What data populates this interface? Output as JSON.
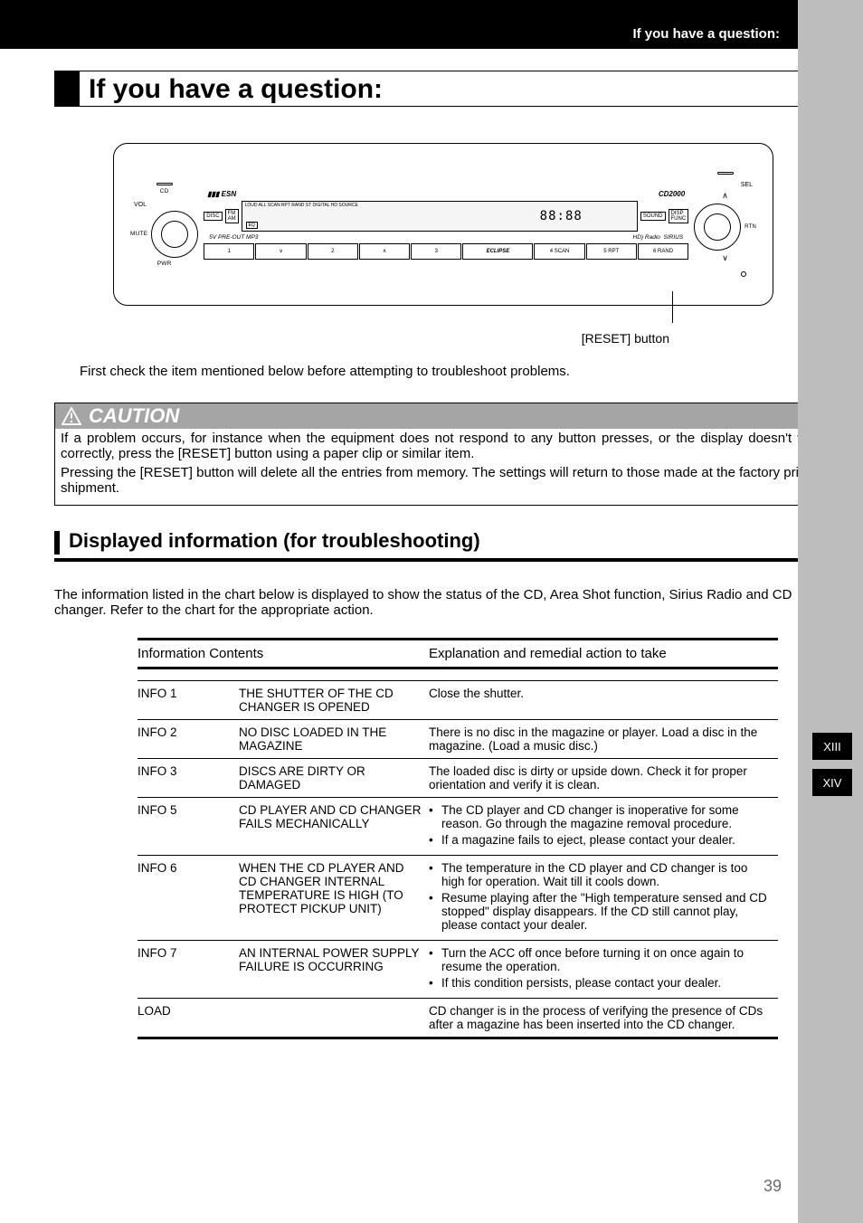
{
  "header_label": "If you have a question:",
  "page_title": "If you have a question:",
  "device": {
    "brand_small": "ESN",
    "model": "CD2000",
    "eclipse": "ECLIPSE",
    "vol": "VOL",
    "sel": "SEL",
    "cd": "CD",
    "disc": "DISC",
    "mute": "MUTE",
    "fm": "FM",
    "am": "AM",
    "pwr": "PWR",
    "sound": "SOUND",
    "disp": "DISP",
    "func": "FUNC",
    "rtn": "RTN",
    "preout": "5V PRE-OUT  MP3",
    "hd": "HD) Radio",
    "sirius": "SIRIUS",
    "lcd_top": "LOUD  ALL SCAN RPT RAND  ST  DIGITAL HD   SOURCE",
    "eq": "EQ",
    "btn1": "1",
    "btn2": "2",
    "btn3": "3",
    "btn4": "4  SCAN",
    "btn5": "5    RPT",
    "btn6": "6  RAND",
    "down": "∨",
    "up": "∧"
  },
  "reset_caption": "[RESET] button",
  "intro": "First check the item mentioned below before attempting to troubleshoot problems.",
  "caution": {
    "title": "CAUTION",
    "p1": "If a problem occurs, for instance when the equipment does not respond to any button presses, or the display doesn't work correctly, press the [RESET] button using a paper clip or similar item.",
    "p2": "Pressing the [RESET] button will delete all the entries from memory. The settings will return to those made at the factory prior to shipment."
  },
  "section_head": "Displayed information (for troubleshooting)",
  "section_intro": "The information listed in the chart below is displayed to show the status of the CD, Area Shot function, Sirius Radio and CD changer. Refer to the chart for the appropriate action.",
  "table": {
    "head_left": "Information Contents",
    "head_right": "Explanation and remedial action to take",
    "rows": [
      {
        "code": "INFO 1",
        "content": "THE SHUTTER OF THE CD CHANGER IS OPENED",
        "expl": [
          "Close the shutter."
        ],
        "plain": true
      },
      {
        "code": "INFO 2",
        "content": "NO DISC LOADED IN THE MAGAZINE",
        "expl": [
          "There is no disc in the magazine or player. Load a disc in the magazine. (Load a music disc.)"
        ],
        "plain": true
      },
      {
        "code": "INFO 3",
        "content": "DISCS ARE DIRTY OR DAMAGED",
        "expl": [
          "The loaded disc is dirty or upside down. Check it for proper orientation and verify it is clean."
        ],
        "plain": true
      },
      {
        "code": "INFO 5",
        "content": "CD PLAYER AND CD CHANGER FAILS MECHANICALLY",
        "expl": [
          "The CD player and CD changer is inoperative for some reason. Go through the magazine removal procedure.",
          "If a magazine fails to eject, please contact your dealer."
        ],
        "plain": false
      },
      {
        "code": "INFO 6",
        "content": "WHEN THE CD PLAYER AND CD CHANGER INTERNAL TEMPERATURE IS HIGH (TO PROTECT PICKUP UNIT)",
        "expl": [
          "The temperature in the CD player and CD changer is too high for operation. Wait till it cools down.",
          "Resume playing after the \"High temperature sensed and CD stopped\" display disappears. If the CD still cannot play, please contact your dealer."
        ],
        "plain": false
      },
      {
        "code": "INFO 7",
        "content": "AN INTERNAL POWER SUPPLY FAILURE IS OCCURRING",
        "expl": [
          "Turn the ACC off once before turning it on once again to resume the operation.",
          "If this condition persists, please contact your dealer."
        ],
        "plain": false
      },
      {
        "code": "LOAD",
        "content": "",
        "expl": [
          "CD changer is in the process of verifying the presence of CDs after a magazine has been inserted into the CD changer."
        ],
        "plain": true
      }
    ]
  },
  "side_tabs": [
    "XIII",
    "XIV"
  ],
  "page_number": "39"
}
